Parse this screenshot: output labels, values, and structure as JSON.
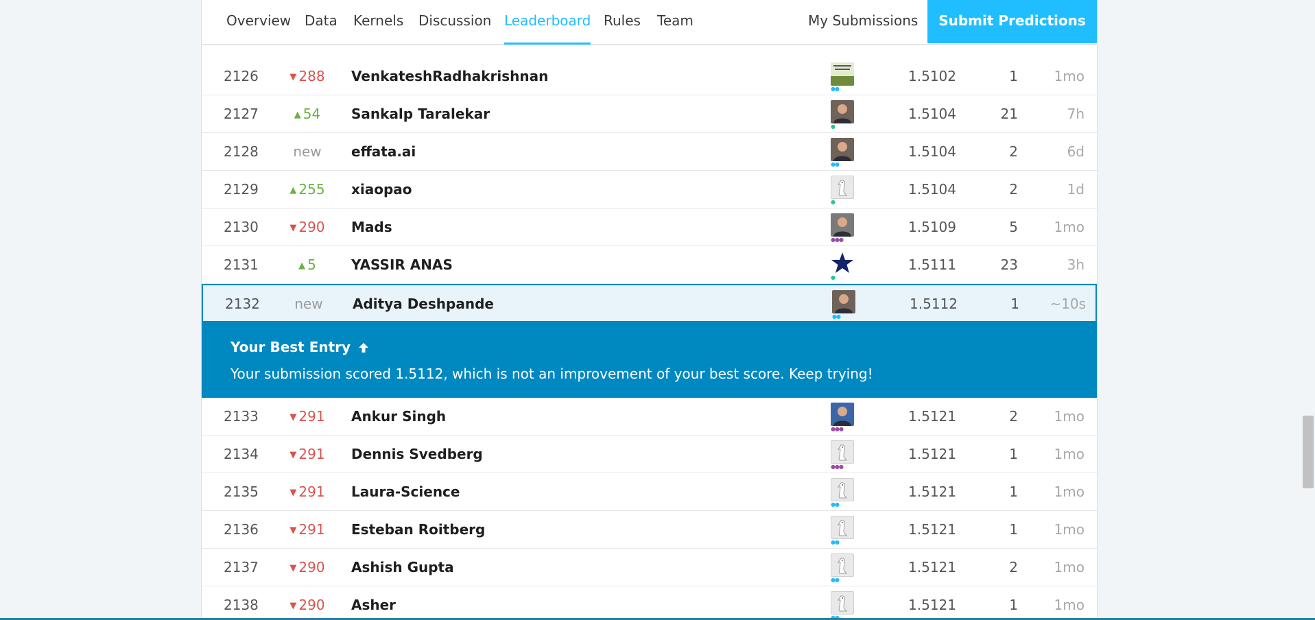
{
  "nav": {
    "tabs": [
      {
        "label": "Overview"
      },
      {
        "label": "Data"
      },
      {
        "label": "Kernels"
      },
      {
        "label": "Discussion"
      },
      {
        "label": "Leaderboard"
      },
      {
        "label": "Rules"
      },
      {
        "label": "Team"
      }
    ],
    "active_tab": "Leaderboard",
    "my_submissions": "My Submissions",
    "submit_predictions": "Submit Predictions"
  },
  "rows": [
    {
      "rank": "2126",
      "change": "288",
      "direction": "down",
      "name": "VenkateshRadhakrishnan",
      "avatar": "green",
      "tier_dots": "teal",
      "score": "1.5102",
      "entries": "1",
      "last": "1mo"
    },
    {
      "rank": "2127",
      "change": "54",
      "direction": "up",
      "name": "Sankalp Taralekar",
      "avatar": "person",
      "tier_dots": "green",
      "score": "1.5104",
      "entries": "21",
      "last": "7h"
    },
    {
      "rank": "2128",
      "change": "new",
      "direction": "new",
      "name": "effata.ai",
      "avatar": "person",
      "tier_dots": "teal",
      "score": "1.5104",
      "entries": "2",
      "last": "6d"
    },
    {
      "rank": "2129",
      "change": "255",
      "direction": "up",
      "name": "xiaopao",
      "avatar": "goose",
      "tier_dots": "green",
      "score": "1.5104",
      "entries": "2",
      "last": "1d"
    },
    {
      "rank": "2130",
      "change": "290",
      "direction": "down",
      "name": "Mads",
      "avatar": "bw",
      "tier_dots": "purple",
      "score": "1.5109",
      "entries": "5",
      "last": "1mo"
    },
    {
      "rank": "2131",
      "change": "5",
      "direction": "up",
      "name": "YASSIR ANAS",
      "avatar": "star",
      "tier_dots": "green",
      "score": "1.5111",
      "entries": "23",
      "last": "3h"
    },
    {
      "rank": "2132",
      "change": "new",
      "direction": "new",
      "name": "Aditya Deshpande",
      "avatar": "person",
      "tier_dots": "teal",
      "score": "1.5112",
      "entries": "1",
      "last": "~10s",
      "mine": true
    },
    {
      "rank": "2133",
      "change": "291",
      "direction": "down",
      "name": "Ankur Singh",
      "avatar": "blue",
      "tier_dots": "purple",
      "score": "1.5121",
      "entries": "2",
      "last": "1mo"
    },
    {
      "rank": "2134",
      "change": "291",
      "direction": "down",
      "name": "Dennis Svedberg",
      "avatar": "goose",
      "tier_dots": "purple",
      "score": "1.5121",
      "entries": "1",
      "last": "1mo"
    },
    {
      "rank": "2135",
      "change": "291",
      "direction": "down",
      "name": "Laura-Science",
      "avatar": "goose",
      "tier_dots": "teal",
      "score": "1.5121",
      "entries": "1",
      "last": "1mo"
    },
    {
      "rank": "2136",
      "change": "291",
      "direction": "down",
      "name": "Esteban Roitberg",
      "avatar": "goose",
      "tier_dots": "teal",
      "score": "1.5121",
      "entries": "1",
      "last": "1mo"
    },
    {
      "rank": "2137",
      "change": "290",
      "direction": "down",
      "name": "Ashish Gupta",
      "avatar": "goose",
      "tier_dots": "teal",
      "score": "1.5121",
      "entries": "2",
      "last": "1mo"
    },
    {
      "rank": "2138",
      "change": "290",
      "direction": "down",
      "name": "Asher",
      "avatar": "goose",
      "tier_dots": "teal",
      "score": "1.5121",
      "entries": "1",
      "last": "1mo"
    }
  ],
  "banner": {
    "title": "Your Best Entry",
    "message": "Your submission scored 1.5112, which is not an improvement of your best score. Keep trying!"
  },
  "colors": {
    "accent": "#20beff",
    "banner": "#0088c0",
    "up": "#6bb33d",
    "down": "#d9534f"
  }
}
